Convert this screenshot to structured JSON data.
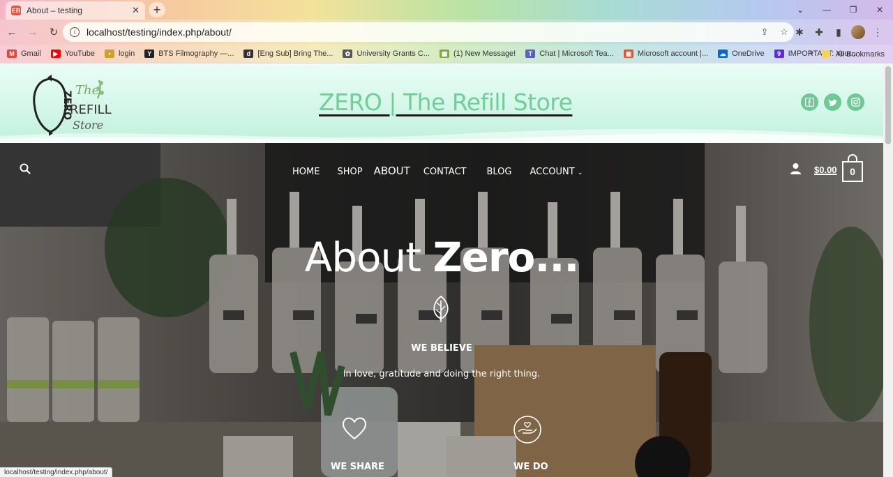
{
  "browser": {
    "tab_title": "About – testing",
    "tab_favicon": "EB",
    "url": "localhost/testing/index.php/about/",
    "status_url": "localhost/testing/index.php/about/"
  },
  "bookmarks": [
    {
      "label": "Gmail",
      "icon": "M",
      "color": "#ea4335"
    },
    {
      "label": "YouTube",
      "icon": "▶",
      "color": "#ff0000"
    },
    {
      "label": "login",
      "icon": "•",
      "color": "#c9a227"
    },
    {
      "label": "BTS Filmography —...",
      "icon": "Y",
      "color": "#222222"
    },
    {
      "label": "[Eng Sub] Bring The...",
      "icon": "d",
      "color": "#333333"
    },
    {
      "label": "University Grants C...",
      "icon": "✿",
      "color": "#555555"
    },
    {
      "label": "(1) New Message!",
      "icon": "▦",
      "color": "#7fa93b"
    },
    {
      "label": "Chat | Microsoft Tea...",
      "icon": "T",
      "color": "#5b5fc7"
    },
    {
      "label": "Microsoft account |...",
      "icon": "▣",
      "color": "#f25022"
    },
    {
      "label": "OneDrive",
      "icon": "☁",
      "color": "#0a64d6"
    },
    {
      "label": "IMPORTANT: Your...",
      "icon": "9",
      "color": "#5b2be0"
    }
  ],
  "bookmarks_more": "»",
  "all_bookmarks": "All Bookmarks",
  "site": {
    "title": "ZERO | The Refill Store",
    "logo_text": "ZERO",
    "logo_script": "The",
    "logo_refill": "REFILL",
    "logo_store": "Store"
  },
  "nav": {
    "items": [
      "HOME",
      "SHOP",
      "ABOUT",
      "CONTACT",
      "BLOG",
      "ACCOUNT"
    ],
    "cart_amount": "$0.00",
    "cart_count": "0"
  },
  "hero": {
    "heading_light": "About ",
    "heading_bold": "Zero...",
    "believe_title": "WE BELIEVE",
    "believe_text": "in love, gratitude and doing the right thing.",
    "share_title": "WE SHARE",
    "do_title": "WE DO"
  },
  "colors": {
    "brand_green": "#6fcf97",
    "social_green": "#6ccb94"
  }
}
